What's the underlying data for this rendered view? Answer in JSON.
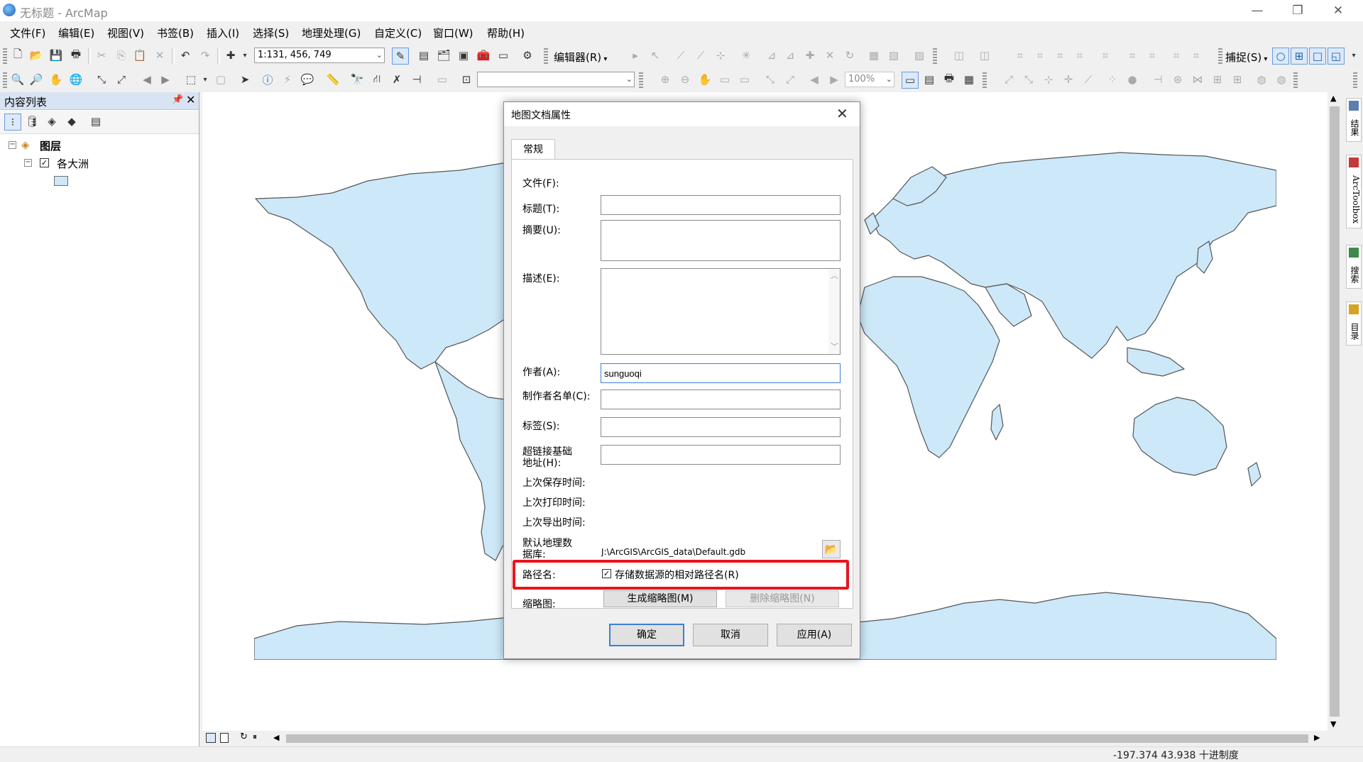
{
  "window": {
    "title": "无标题 - ArcMap"
  },
  "menu": [
    "文件(F)",
    "编辑(E)",
    "视图(V)",
    "书签(B)",
    "插入(I)",
    "选择(S)",
    "地理处理(G)",
    "自定义(C)",
    "窗口(W)",
    "帮助(H)"
  ],
  "toolbar": {
    "scale_value": "1:131, 456, 749",
    "editor_label": "编辑器(R)",
    "snapping_label": "捕捉(S)",
    "zoom_value": "100%"
  },
  "toc": {
    "title": "内容列表",
    "root_label": "图层",
    "layer_label": "各大洲"
  },
  "right_dock": [
    "结果",
    "ArcToolbox",
    "搜索",
    "目录"
  ],
  "status": {
    "coords": "-197.374  43.938 十进制度"
  },
  "colors": {
    "land": "#cde8f8",
    "highlight": "#e8141e",
    "focus": "#3c7fd6"
  },
  "dialog": {
    "title": "地图文档属性",
    "tab": "常规",
    "labels": {
      "file": "文件(F):",
      "title": "标题(T):",
      "summary": "摘要(U):",
      "description": "描述(E):",
      "author": "作者(A):",
      "credits": "制作者名单(C):",
      "tags": "标签(S):",
      "hyperlink_1": "超链接基础",
      "hyperlink_2": "地址(H):",
      "last_saved": "上次保存时间:",
      "last_printed": "上次打印时间:",
      "last_exported": "上次导出时间:",
      "default_gdb_1": "默认地理数",
      "default_gdb_2": "据库:",
      "pathnames": "路径名:",
      "thumbnail": "缩略图:"
    },
    "values": {
      "title": "",
      "summary": "",
      "description": "",
      "author": "sunguoqi",
      "credits": "",
      "tags": "",
      "hyperlink": "",
      "default_gdb": "J:\\ArcGIS\\ArcGIS_data\\Default.gdb"
    },
    "relative_paths_label": "存储数据源的相对路径名(R)",
    "relative_paths_checked": true,
    "make_thumbnail": "生成缩略图(M)",
    "delete_thumbnail": "删除缩略图(N)",
    "ok": "确定",
    "cancel": "取消",
    "apply": "应用(A)"
  }
}
